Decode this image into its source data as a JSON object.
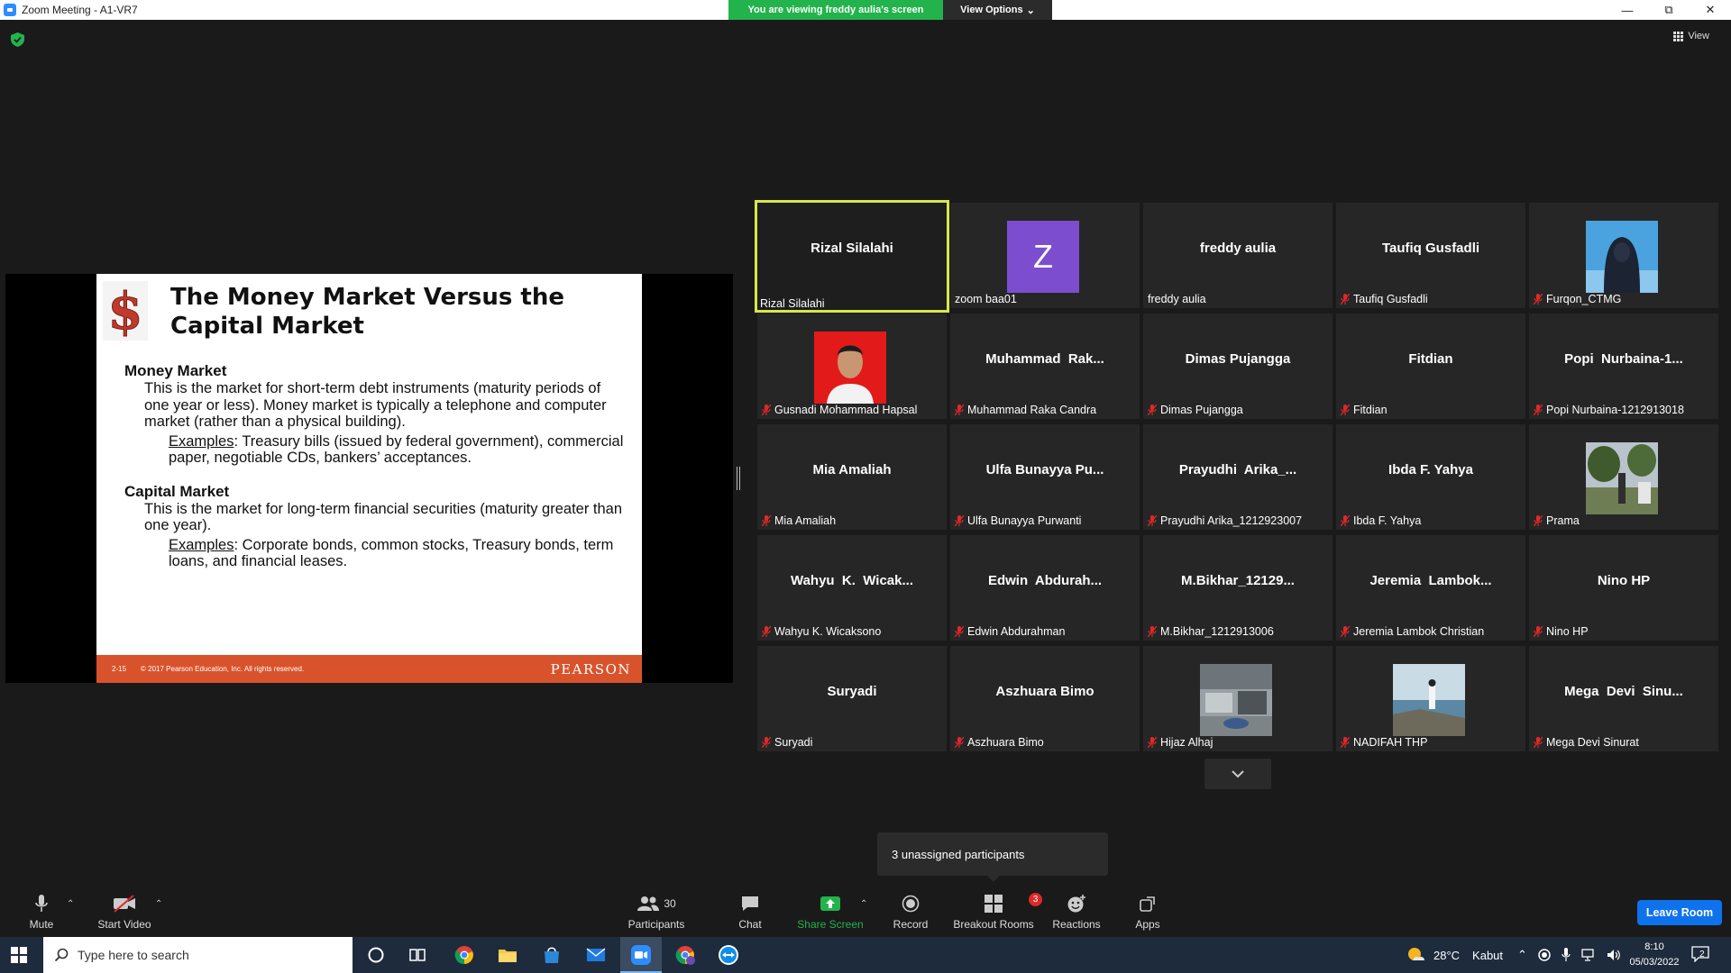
{
  "window": {
    "title": "Zoom Meeting - A1-VR7",
    "viewing_banner": "You are viewing freddy aulia's screen",
    "view_options": "View Options",
    "top_right_view": "View"
  },
  "slide": {
    "title": "The Money Market Versus the Capital Market",
    "sections": [
      {
        "heading": "Money Market",
        "text": "This is the market for short-term debt instruments (maturity periods of one year or less). Money market is typically a telephone and computer market (rather than a physical building).",
        "examples_label": "Examples",
        "examples_text": ": Treasury bills (issued by federal government), commercial paper, negotiable CDs, bankers’ acceptances."
      },
      {
        "heading": "Capital Market",
        "text": "This is the market for long-term financial securities (maturity greater than one year).",
        "examples_label": "Examples",
        "examples_text": ": Corporate bonds, common stocks, Treasury bonds, term loans, and financial leases."
      }
    ],
    "footer_page": "2-15",
    "footer_copyright": "© 2017 Pearson Education, Inc. All rights reserved.",
    "footer_brand": "PEARSON"
  },
  "participants": [
    {
      "big": "Rizal Silalahi",
      "label": "Rizal Silalahi",
      "muted": false,
      "active": true,
      "kind": "name"
    },
    {
      "big": "Z",
      "label": "zoom baa01",
      "muted": false,
      "kind": "letter"
    },
    {
      "big": "freddy aulia",
      "label": "freddy aulia",
      "muted": false,
      "kind": "name"
    },
    {
      "big": "Taufiq Gusfadli",
      "label": "Taufiq Gusfadli",
      "muted": true,
      "kind": "name"
    },
    {
      "big": "",
      "label": "Furqon_CTMG",
      "muted": true,
      "kind": "photo-hood"
    },
    {
      "big": "",
      "label": "Gusnadi Mohammad Hapsal",
      "muted": true,
      "kind": "photo-red"
    },
    {
      "big": "Muhammad  Rak...",
      "label": "Muhammad Raka Candra",
      "muted": true,
      "kind": "name"
    },
    {
      "big": "Dimas Pujangga",
      "label": "Dimas Pujangga",
      "muted": true,
      "kind": "name"
    },
    {
      "big": "Fitdian",
      "label": "Fitdian",
      "muted": true,
      "kind": "name"
    },
    {
      "big": "Popi  Nurbaina-1...",
      "label": "Popi Nurbaina-1212913018",
      "muted": true,
      "kind": "name"
    },
    {
      "big": "Mia Amaliah",
      "label": "Mia Amaliah",
      "muted": true,
      "kind": "name"
    },
    {
      "big": "Ulfa Bunayya Pu...",
      "label": "Ulfa Bunayya Purwanti",
      "muted": true,
      "kind": "name"
    },
    {
      "big": "Prayudhi  Arika_...",
      "label": "Prayudhi Arika_1212923007",
      "muted": true,
      "kind": "name"
    },
    {
      "big": "Ibda F. Yahya",
      "label": "Ibda F. Yahya",
      "muted": true,
      "kind": "name"
    },
    {
      "big": "",
      "label": "Prama",
      "muted": true,
      "kind": "photo-garden"
    },
    {
      "big": "Wahyu  K.  Wicak...",
      "label": "Wahyu K. Wicaksono",
      "muted": true,
      "kind": "name"
    },
    {
      "big": "Edwin  Abdurah...",
      "label": "Edwin Abdurahman",
      "muted": true,
      "kind": "name"
    },
    {
      "big": "M.Bikhar_12129...",
      "label": "M.Bikhar_1212913006",
      "muted": true,
      "kind": "name"
    },
    {
      "big": "Jeremia  Lambok...",
      "label": "Jeremia Lambok Christian",
      "muted": true,
      "kind": "name"
    },
    {
      "big": "Nino HP",
      "label": "Nino HP",
      "muted": true,
      "kind": "name"
    },
    {
      "big": "Suryadi",
      "label": "Suryadi",
      "muted": true,
      "kind": "name"
    },
    {
      "big": "Aszhuara Bimo",
      "label": "Aszhuara Bimo",
      "muted": true,
      "kind": "name"
    },
    {
      "big": "",
      "label": "Hijaz Alhaj",
      "muted": true,
      "kind": "photo-gray"
    },
    {
      "big": "",
      "label": "NADIFAH THP",
      "muted": true,
      "kind": "photo-sea"
    },
    {
      "big": "Mega  Devi  Sinu...",
      "label": "Mega Devi Sinurat",
      "muted": true,
      "kind": "name"
    }
  ],
  "unassigned": "3 unassigned participants",
  "toolbar": {
    "mute": "Mute",
    "start_video": "Start Video",
    "participants": "Participants",
    "participants_count": "30",
    "chat": "Chat",
    "share_screen": "Share Screen",
    "record": "Record",
    "breakout_rooms": "Breakout Rooms",
    "breakout_badge": "3",
    "reactions": "Reactions",
    "apps": "Apps",
    "leave_room": "Leave Room"
  },
  "taskbar": {
    "search_placeholder": "Type here to search",
    "weather_temp": "28°C",
    "weather_text": "Kabut",
    "time": "8:10",
    "date": "05/03/2022",
    "notification_count": "2"
  },
  "colors": {
    "accent_blue": "#0e72ed",
    "share_green": "#23b34c",
    "active_speaker": "#d7e84a",
    "pearson_orange": "#d8532c",
    "mute_red": "#e02828"
  }
}
